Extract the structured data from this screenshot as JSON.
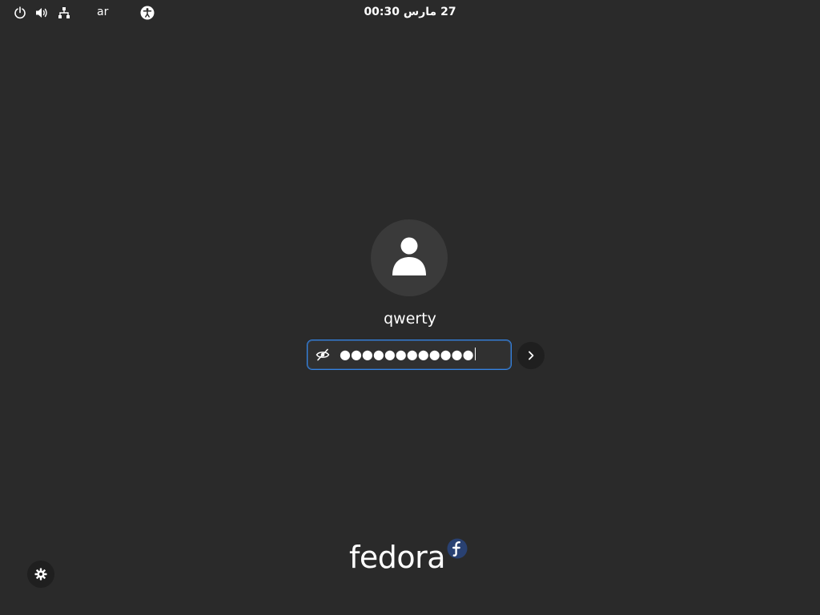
{
  "top_bar": {
    "language": "ar",
    "clock": "27 مارس 00:30",
    "icons": [
      "power-icon",
      "volume-icon",
      "network-icon",
      "accessibility-icon"
    ]
  },
  "login": {
    "avatar_icon": "user-avatar-icon",
    "username": "qwerty",
    "password_masked": "●●●●●●●●●●●●",
    "reveal_icon": "eye-slash-icon",
    "submit_icon": "chevron-right-icon"
  },
  "branding": {
    "logo_text": "fedora",
    "logo_badge_icon": "fedora-infinity-icon",
    "accent_color": "#3584e4",
    "logo_color": "#294172"
  },
  "settings": {
    "icon": "gear-icon"
  }
}
